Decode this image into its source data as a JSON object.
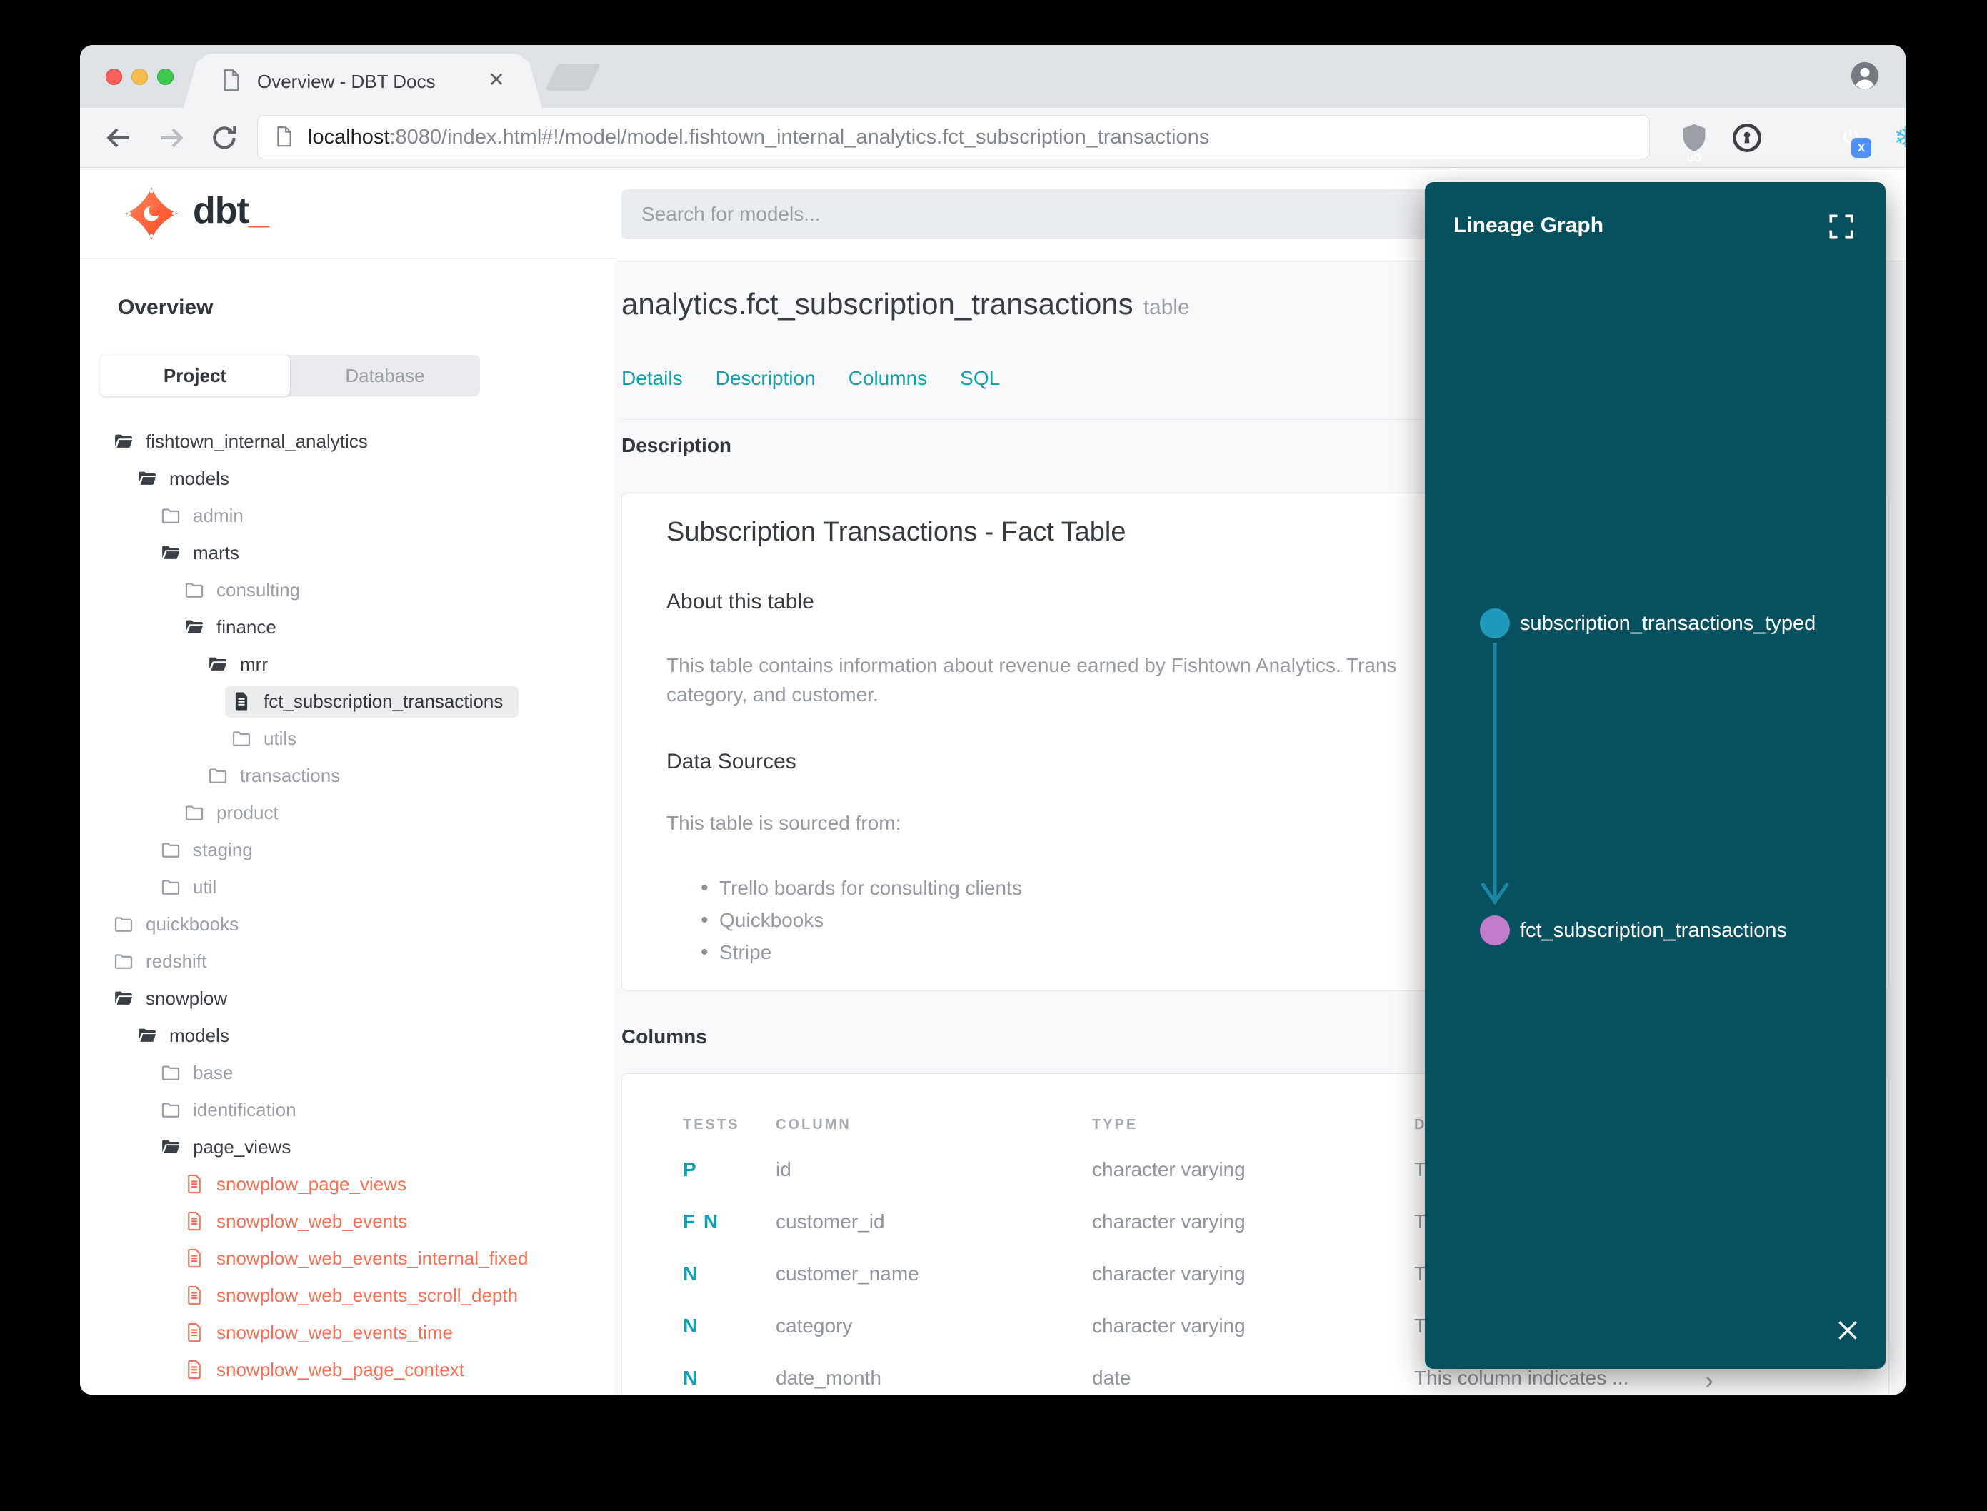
{
  "browser": {
    "tab_title": "Overview - DBT Docs",
    "url": {
      "host": "localhost",
      "rest": ":8080/index.html#!/model/model.fishtown_internal_analytics.fct_subscription_transactions"
    },
    "ublock_label": "uO",
    "badge_label": "x"
  },
  "app_header": {
    "brand": "dbt",
    "brand_suffix": "_",
    "search_placeholder": "Search for models..."
  },
  "sidebar": {
    "overview_label": "Overview",
    "source_tabs": [
      {
        "label": "Project",
        "active": true
      },
      {
        "label": "Database",
        "active": false
      }
    ],
    "tree": [
      {
        "label": "fishtown_internal_analytics",
        "level": 0,
        "icon": "folder-open"
      },
      {
        "label": "models",
        "level": 1,
        "icon": "folder-open"
      },
      {
        "label": "admin",
        "level": 2,
        "icon": "folder"
      },
      {
        "label": "marts",
        "level": 2,
        "icon": "folder-open"
      },
      {
        "label": "consulting",
        "level": 3,
        "icon": "folder"
      },
      {
        "label": "finance",
        "level": 3,
        "icon": "folder-open"
      },
      {
        "label": "mrr",
        "level": 4,
        "icon": "folder-open"
      },
      {
        "label": "fct_subscription_transactions",
        "level": 5,
        "icon": "file",
        "selected": true
      },
      {
        "label": "utils",
        "level": 5,
        "icon": "folder"
      },
      {
        "label": "transactions",
        "level": 4,
        "icon": "folder"
      },
      {
        "label": "product",
        "level": 3,
        "icon": "folder"
      },
      {
        "label": "staging",
        "level": 2,
        "icon": "folder"
      },
      {
        "label": "util",
        "level": 2,
        "icon": "folder"
      },
      {
        "label": "quickbooks",
        "level": 0,
        "icon": "folder"
      },
      {
        "label": "redshift",
        "level": 0,
        "icon": "folder"
      },
      {
        "label": "snowplow",
        "level": 0,
        "icon": "folder-open"
      },
      {
        "label": "models",
        "level": 1,
        "icon": "folder-open"
      },
      {
        "label": "base",
        "level": 2,
        "icon": "folder"
      },
      {
        "label": "identification",
        "level": 2,
        "icon": "folder"
      },
      {
        "label": "page_views",
        "level": 2,
        "icon": "folder-open"
      },
      {
        "label": "snowplow_page_views",
        "level": 3,
        "icon": "file-red"
      },
      {
        "label": "snowplow_web_events",
        "level": 3,
        "icon": "file-red"
      },
      {
        "label": "snowplow_web_events_internal_fixed",
        "level": 3,
        "icon": "file-red"
      },
      {
        "label": "snowplow_web_events_scroll_depth",
        "level": 3,
        "icon": "file-red"
      },
      {
        "label": "snowplow_web_events_time",
        "level": 3,
        "icon": "file-red"
      },
      {
        "label": "snowplow_web_page_context",
        "level": 3,
        "icon": "file-red"
      }
    ]
  },
  "model": {
    "title": "analytics.fct_subscription_transactions",
    "title_badge": "table",
    "tabs": [
      "Details",
      "Description",
      "Columns",
      "SQL"
    ],
    "description_heading": "Description",
    "doc": {
      "title": "Subscription Transactions - Fact Table",
      "about_heading": "About this table",
      "about_lines": [
        "This table contains information about revenue earned by Fishtown Analytics. Trans",
        "category, and customer."
      ],
      "sources_heading": "Data Sources",
      "sources_intro": "This table is sourced from:",
      "sources": [
        "Trello boards for consulting clients",
        "Quickbooks",
        "Stripe"
      ]
    },
    "columns_heading": "Columns",
    "columns_table": {
      "headers": [
        "TESTS",
        "COLUMN",
        "TYPE",
        "DESCRIPTION"
      ],
      "rows": [
        {
          "tests": "P",
          "column": "id",
          "type": "character varying",
          "description": "T"
        },
        {
          "tests": "F N",
          "column": "customer_id",
          "type": "character varying",
          "description": "T"
        },
        {
          "tests": "N",
          "column": "customer_name",
          "type": "character varying",
          "description": "T"
        },
        {
          "tests": "N",
          "column": "category",
          "type": "character varying",
          "description": "T"
        },
        {
          "tests": "N",
          "column": "date_month",
          "type": "date",
          "description": "This column indicates ...",
          "chevron": "›"
        }
      ]
    }
  },
  "lineage": {
    "title": "Lineage Graph",
    "panel_color": "#07505f",
    "nodes": [
      {
        "label": "subscription_transactions_typed",
        "color": "#209abc"
      },
      {
        "label": "fct_subscription_transactions",
        "color": "#c27dca"
      }
    ],
    "edge_color": "#1b87a5"
  }
}
